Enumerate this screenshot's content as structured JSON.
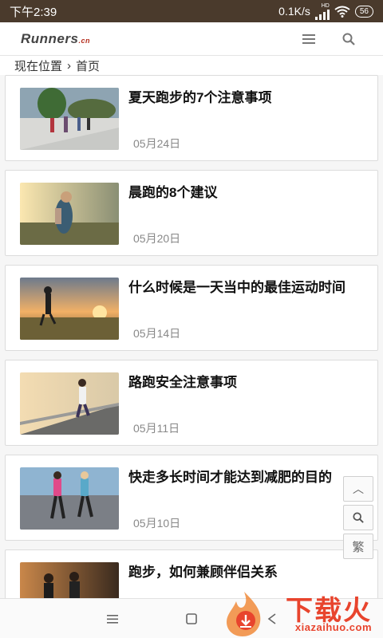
{
  "status_bar": {
    "time": "下午2:39",
    "net_speed": "0.1K/s",
    "hd_label": "HD",
    "battery": "56"
  },
  "header": {
    "logo": "Runners",
    "logo_suffix": ".cn",
    "menu_icon": "hamburger-menu-icon",
    "search_icon": "search-icon"
  },
  "breadcrumb": {
    "prefix": "现在位置",
    "separator": "›",
    "current": "首页"
  },
  "articles": [
    {
      "title": "夏天跑步的7个注意事项",
      "date": "05月24日",
      "thumb": "summer-runners-photo"
    },
    {
      "title": "晨跑的8个建议",
      "date": "05月20日",
      "thumb": "morning-runner-photo"
    },
    {
      "title": "什么时候是一天当中的最佳运动时间",
      "date": "05月14日",
      "thumb": "sunset-runner-photo"
    },
    {
      "title": "路跑安全注意事项",
      "date": "05月11日",
      "thumb": "road-runner-photo"
    },
    {
      "title": "快走多长时间才能达到减肥的目的",
      "date": "05月10日",
      "thumb": "walking-women-photo"
    },
    {
      "title": "跑步，如何兼顾伴侣关系",
      "date": "",
      "thumb": "couple-runners-photo"
    }
  ],
  "float_buttons": {
    "top": "︿",
    "search_icon": "search-icon",
    "traditional": "繁"
  },
  "watermark": {
    "text": "下载火",
    "url": "xiazaihuo.com"
  },
  "colors": {
    "status_bar": "#4a3a2c",
    "watermark": "#e8442d"
  }
}
